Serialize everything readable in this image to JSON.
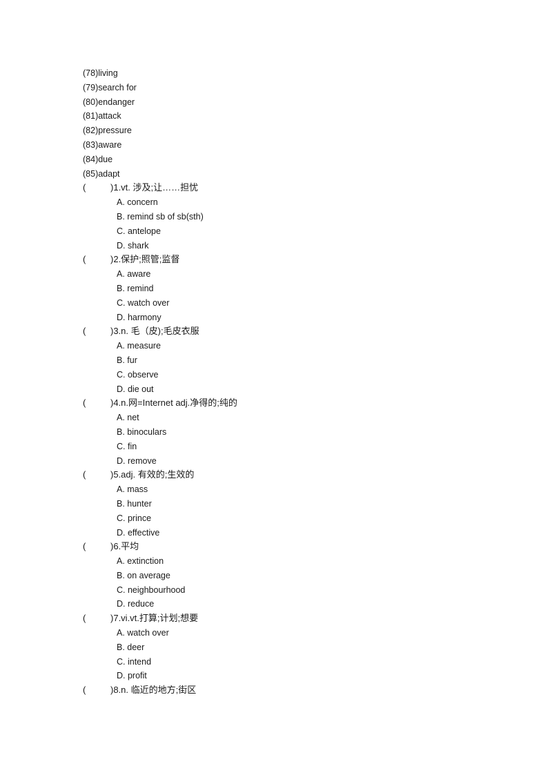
{
  "answer_list": [
    "(78)living",
    "(79)search for",
    "(80)endanger",
    "(81)attack",
    "(82)pressure",
    "(83)aware",
    "(84)due",
    "(85)adapt"
  ],
  "questions": [
    {
      "prompt": "1.vt.  涉及;让……担忧",
      "options": [
        "A. concern",
        "B. remind sb of sb(sth)",
        "C. antelope",
        "D. shark"
      ]
    },
    {
      "prompt": "2.保护;照管;监督",
      "options": [
        "A. aware",
        "B. remind",
        "C. watch over",
        "D. harmony"
      ]
    },
    {
      "prompt": "3.n.  毛（皮);毛皮衣服",
      "options": [
        "A. measure",
        "B. fur",
        "C. observe",
        "D. die out"
      ]
    },
    {
      "prompt": "4.n.网=Internet adj.净得的;纯的",
      "options": [
        "A. net",
        "B. binoculars",
        "C. fin",
        "D. remove"
      ]
    },
    {
      "prompt": "5.adj.  有效的;生效的",
      "options": [
        "A. mass",
        "B. hunter",
        "C. prince",
        "D. effective"
      ]
    },
    {
      "prompt": "6.平均",
      "options": [
        "A. extinction",
        "B. on average",
        "C. neighbourhood",
        "D. reduce"
      ]
    },
    {
      "prompt": "7.vi.vt.打算;计划;想要",
      "options": [
        "A. watch over",
        "B. deer",
        "C. intend",
        "D. profit"
      ]
    },
    {
      "prompt": "8.n.  临近的地方;街区",
      "options": []
    }
  ],
  "paren_open": "(",
  "paren_close": ")"
}
